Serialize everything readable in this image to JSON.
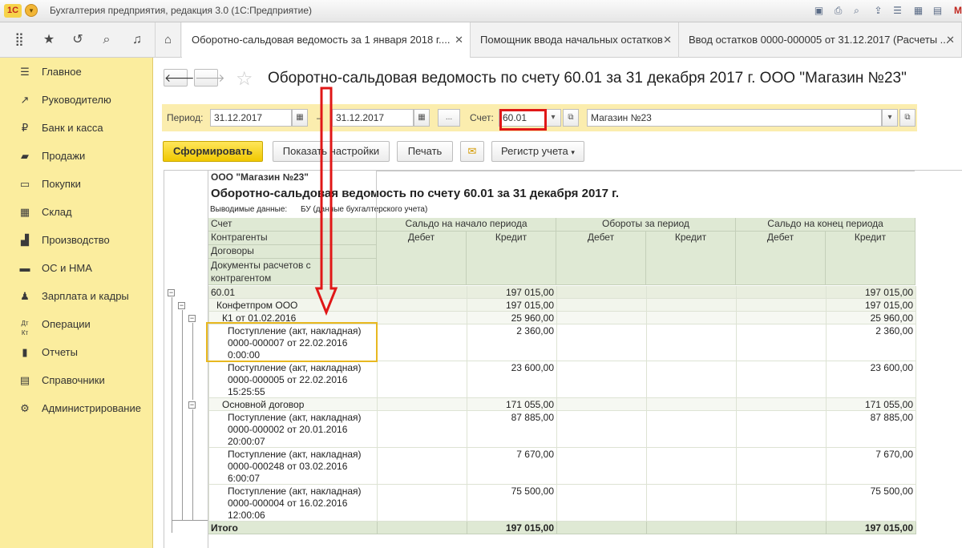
{
  "window": {
    "logo": "1С",
    "title": "Бухгалтерия предприятия, редакция 3.0 (1С:Предприятие)",
    "right_letter": "M"
  },
  "tabs": [
    {
      "label": "Оборотно-сальдовая ведомость за 1 января 2018 г...."
    },
    {
      "label": "Помощник ввода начальных остатков"
    },
    {
      "label": "Ввод остатков 0000-000005 от 31.12.2017 (Расчеты ..."
    }
  ],
  "sidebar": {
    "items": [
      {
        "label": "Главное",
        "icon": "menu-lines-icon"
      },
      {
        "label": "Руководителю",
        "icon": "trend-arrow-icon"
      },
      {
        "label": "Банк и касса",
        "icon": "ruble-coin-icon"
      },
      {
        "label": "Продажи",
        "icon": "shopping-bag-icon"
      },
      {
        "label": "Покупки",
        "icon": "cart-icon"
      },
      {
        "label": "Склад",
        "icon": "warehouse-grid-icon"
      },
      {
        "label": "Производство",
        "icon": "factory-icon"
      },
      {
        "label": "ОС и НМА",
        "icon": "truck-icon"
      },
      {
        "label": "Зарплата и кадры",
        "icon": "person-icon"
      },
      {
        "label": "Операции",
        "icon": "dt-kt-icon"
      },
      {
        "label": "Отчеты",
        "icon": "chart-icon"
      },
      {
        "label": "Справочники",
        "icon": "book-icon"
      },
      {
        "label": "Администрирование",
        "icon": "gear-icon"
      }
    ]
  },
  "report": {
    "title": "Оборотно-сальдовая ведомость по счету 60.01 за 31 декабря 2017 г. ООО \"Магазин №23\"",
    "params": {
      "period_label": "Период:",
      "date_from": "31.12.2017",
      "dash": "–",
      "date_to": "31.12.2017",
      "dots": "...",
      "account_label": "Счет:",
      "account": "60.01",
      "organization": "Магазин №23"
    },
    "buttons": {
      "generate": "Сформировать",
      "settings": "Показать настройки",
      "print": "Печать",
      "register": "Регистр учета"
    }
  },
  "sheet": {
    "org": "ООО \"Магазин №23\"",
    "heading": "Оборотно-сальдовая ведомость по счету 60.01 за 31 декабря 2017 г.",
    "output_label": "Выводимые данные:",
    "output_value": "БУ (данные бухгалтерского учета)",
    "col_headers": {
      "account": "Счет",
      "counterparties": "Контрагенты",
      "contracts": "Договоры",
      "documents": "Документы расчетов с контрагентом",
      "opening": "Сальдо на начало периода",
      "turnover": "Обороты за период",
      "closing": "Сальдо на конец периода",
      "debit": "Дебет",
      "credit": "Кредит"
    },
    "rows": [
      {
        "name": "60.01",
        "open_credit": "197 015,00",
        "close_credit": "197 015,00"
      },
      {
        "name": "Конфетпром ООО",
        "open_credit": "197 015,00",
        "close_credit": "197 015,00"
      },
      {
        "name": "К1 от 01.02.2016",
        "open_credit": "25 960,00",
        "close_credit": "25 960,00"
      },
      {
        "l1": "Поступление (акт, накладная)",
        "l2": "0000-000007 от 22.02.2016",
        "l3": "0:00:00",
        "open_credit": "2 360,00",
        "close_credit": "2 360,00"
      },
      {
        "l1": "Поступление (акт, накладная)",
        "l2": "0000-000005 от 22.02.2016",
        "l3": "15:25:55",
        "open_credit": "23 600,00",
        "close_credit": "23 600,00"
      },
      {
        "name": "Основной договор",
        "open_credit": "171 055,00",
        "close_credit": "171 055,00"
      },
      {
        "l1": "Поступление (акт, накладная)",
        "l2": "0000-000002 от 20.01.2016",
        "l3": "20:00:07",
        "open_credit": "87 885,00",
        "close_credit": "87 885,00"
      },
      {
        "l1": "Поступление (акт, накладная)",
        "l2": "0000-000248 от 03.02.2016",
        "l3": "6:00:07",
        "open_credit": "7 670,00",
        "close_credit": "7 670,00"
      },
      {
        "l1": "Поступление (акт, накладная)",
        "l2": "0000-000004 от 16.02.2016",
        "l3": "12:00:06",
        "open_credit": "75 500,00",
        "close_credit": "75 500,00"
      }
    ],
    "total": {
      "label": "Итого",
      "open_credit": "197 015,00",
      "close_credit": "197 015,00"
    }
  },
  "colors": {
    "sidebar_bg": "#fbed9e",
    "params_bg": "#fbedae",
    "header_green": "#dfe9d4",
    "accent_yellow": "#f0c800",
    "highlight_red": "#e01717"
  }
}
